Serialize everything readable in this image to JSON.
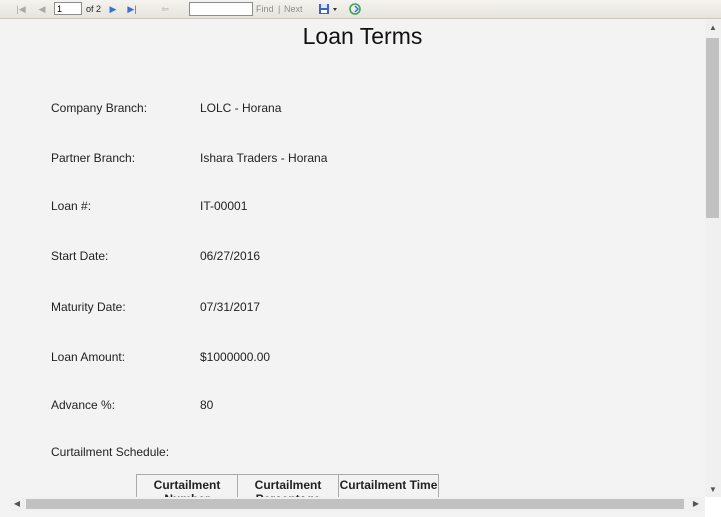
{
  "toolbar": {
    "page_current": "1",
    "page_of": "of 2",
    "find_value": "",
    "find_label": "Find",
    "separator": "|",
    "next_label": "Next",
    "icons": {
      "first": "first-page-icon",
      "prev": "previous-page-icon",
      "next": "next-page-icon",
      "last": "last-page-icon",
      "back": "back-to-parent-icon",
      "export": "export-save-icon",
      "refresh": "refresh-icon"
    }
  },
  "report": {
    "title": "Loan Terms",
    "fields": [
      {
        "label": "Company Branch:",
        "value": "LOLC - Horana"
      },
      {
        "label": "Partner Branch:",
        "value": "Ishara Traders - Horana"
      },
      {
        "label": "Loan #:",
        "value": "IT-00001"
      },
      {
        "label": "Start Date:",
        "value": "06/27/2016"
      },
      {
        "label": "Maturity Date:",
        "value": "07/31/2017"
      },
      {
        "label": "Loan Amount:",
        "value": "$1000000.00"
      },
      {
        "label": "Advance %:",
        "value": "80"
      }
    ],
    "schedule_label": "Curtailment Schedule:",
    "schedule_headers": [
      "Curtailment Number",
      "Curtailment Percentage",
      "Curtailment Time"
    ]
  }
}
